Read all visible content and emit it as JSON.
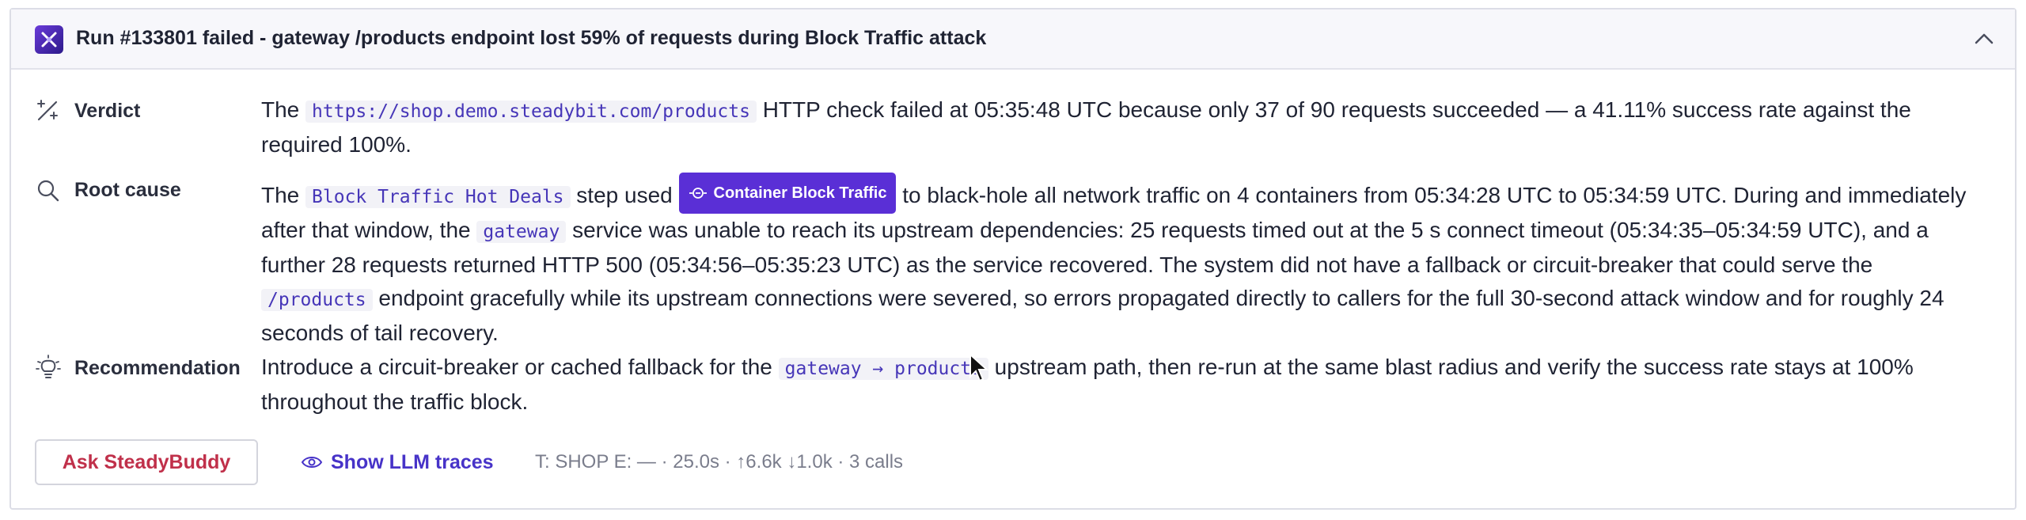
{
  "header": {
    "title": "Run #133801 failed - gateway /products endpoint lost 59% of requests during Block Traffic attack",
    "logo_icon": "steadybit-logo-icon",
    "collapse_icon": "chevron-up-icon"
  },
  "verdict": {
    "label": "Verdict",
    "icon": "wand-sparkle-icon",
    "t1": "The ",
    "url": "https://shop.demo.steadybit.com/products",
    "t2": " HTTP check failed at 05:35:48 UTC because only 37 of 90 requests succeeded — a 41.11% success rate against the required 100%."
  },
  "root_cause": {
    "label": "Root cause",
    "icon": "search-icon",
    "t1": "The ",
    "step": "Block Traffic Hot Deals",
    "t2": " step used ",
    "chip": "Container Block Traffic",
    "t3": " to black-hole all network traffic on 4 containers from 05:34:28 UTC to 05:34:59 UTC. During and immediately after that window, the ",
    "service": "gateway",
    "t4": " service was unable to reach its upstream dependencies: 25 requests timed out at the 5 s connect timeout (05:34:35–05:34:59 UTC), and a further 28 requests returned HTTP 500 (05:34:56–05:35:23 UTC) as the service recovered. The system did not have a fallback or circuit-breaker that could serve the ",
    "endpoint": "/products",
    "t5": " endpoint gracefully while its upstream connections were severed, so errors propagated directly to callers for the full 30-second attack window and for roughly 24 seconds of tail recovery."
  },
  "recommendation": {
    "label": "Recommendation",
    "icon": "lightbulb-icon",
    "t1": "Introduce a circuit-breaker or cached fallback for the ",
    "path": "gateway → products",
    "t2": " upstream path, then re-run at the same blast radius and verify the success rate stays at 100% throughout the traffic block."
  },
  "footer": {
    "ask_label": "Ask SteadyBuddy",
    "llm_label": "Show LLM traces",
    "llm_icon": "eye-icon",
    "meta": "T: SHOP E: — · 25.0s · ↑6.6k ↓1.0k · 3 calls"
  },
  "colors": {
    "accent": "#5a2fd6",
    "link": "#4733c8",
    "danger": "#c0304a",
    "code": "#4636b8"
  }
}
